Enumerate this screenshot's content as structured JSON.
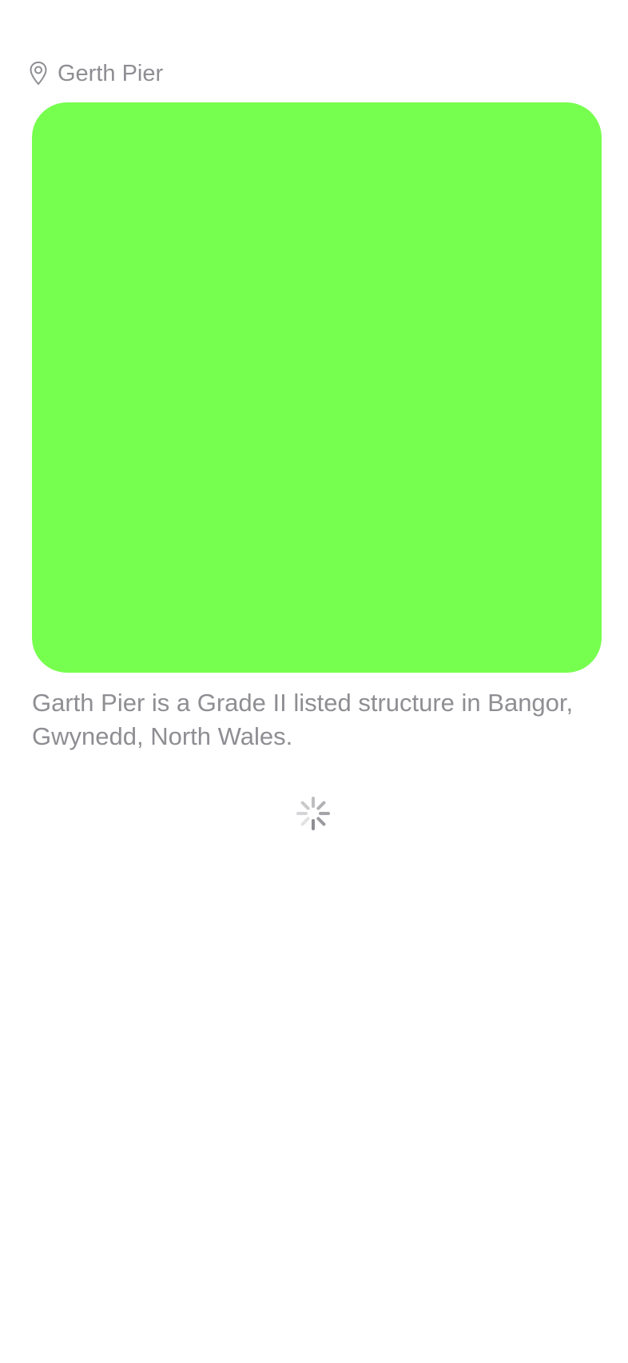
{
  "location": {
    "icon": "map-pin-icon",
    "name": "Gerth Pier"
  },
  "photo": {
    "color": "#77ff4f"
  },
  "description": "Garth Pier is a Grade II listed structure in Bangor, Gwynedd, North Wales.",
  "loading": {
    "icon": "activity-spinner-icon"
  }
}
